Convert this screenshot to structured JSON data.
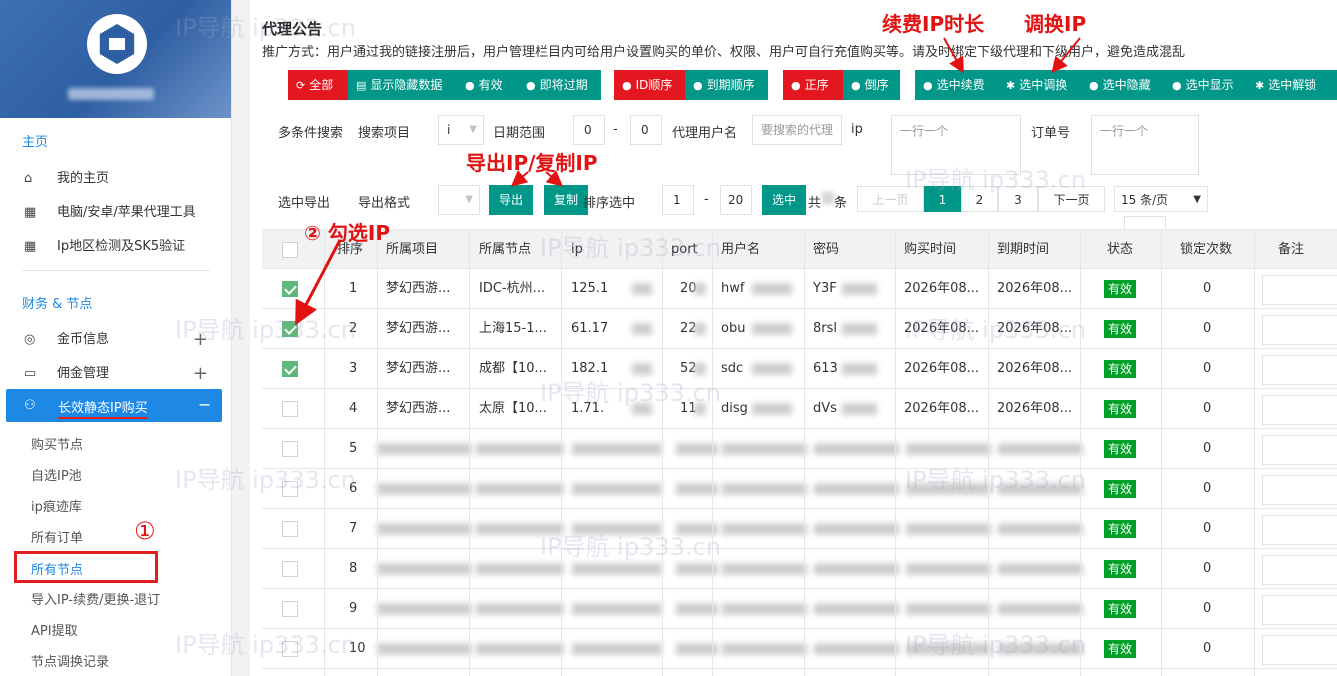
{
  "sidebar": {
    "section_main": "主页",
    "items_main": [
      {
        "label": "我的主页",
        "icon": "home-icon"
      },
      {
        "label": "电脑/安卓/苹果代理工具",
        "icon": "grid-icon"
      },
      {
        "label": "Ip地区检测及SK5验证",
        "icon": "grid-icon"
      }
    ],
    "section_finance": "财务 & 节点",
    "items_finance": [
      {
        "label": "金币信息",
        "toggle": "+"
      },
      {
        "label": "佣金管理",
        "toggle": "+"
      }
    ],
    "active_item": {
      "label": "长效静态IP购买",
      "toggle": "−"
    },
    "sub_items": [
      "购买节点",
      "自选IP池",
      "ip痕迹库",
      "所有订单",
      "所有节点",
      "导入IP-续费/更换-退订",
      "API提取",
      "节点调换记录"
    ]
  },
  "notice": {
    "title": "代理公告",
    "text": "推广方式：用户通过我的链接注册后，用户管理栏目内可给用户设置购买的单价、权限、用户可自行充值购买等。请及时绑定下级代理和下级用户，避免造成混乱"
  },
  "toolbar": [
    {
      "label": "全部",
      "color": "red",
      "icon": "cycle-icon"
    },
    {
      "label": "显示隐藏数据",
      "color": "teal",
      "icon": "list-icon"
    },
    {
      "label": "有效",
      "color": "teal",
      "icon": "check-circle-icon"
    },
    {
      "label": "即将过期",
      "color": "teal",
      "icon": "check-circle-icon"
    },
    {
      "label": "ID顺序",
      "color": "red",
      "icon": "check-circle-icon"
    },
    {
      "label": "到期顺序",
      "color": "teal",
      "icon": "check-circle-icon"
    },
    {
      "label": "正序",
      "color": "red",
      "icon": "check-circle-icon"
    },
    {
      "label": "倒序",
      "color": "teal",
      "icon": "check-circle-icon"
    },
    {
      "label": "选中续费",
      "color": "teal",
      "icon": "check-circle-icon"
    },
    {
      "label": "选中调换",
      "color": "teal",
      "icon": "gear-icon"
    },
    {
      "label": "选中隐藏",
      "color": "teal",
      "icon": "check-circle-icon"
    },
    {
      "label": "选中显示",
      "color": "teal",
      "icon": "check-circle-icon"
    },
    {
      "label": "选中解锁",
      "color": "teal",
      "icon": "gear-icon"
    }
  ],
  "filters": {
    "multi_label": "多条件搜索",
    "project_label": "搜索项目",
    "project_value": "i",
    "date_label": "日期范围",
    "date_from": "0",
    "date_sep": "-",
    "date_to": "0",
    "agent_label": "代理用户名",
    "agent_placeholder": "要搜索的代理",
    "ip_label": "ip",
    "ip_placeholder": "一行一个",
    "order_label": "订单号",
    "order_placeholder": "一行一个"
  },
  "export": {
    "label": "选中导出",
    "format_label": "导出格式",
    "export_btn": "导出",
    "copy_btn": "复制",
    "sort_label": "排序选中",
    "range_from": "1",
    "range_sep": "-",
    "range_to": "20",
    "select_btn": "选中",
    "total_prefix": "共",
    "total_suffix": "条"
  },
  "pagination": {
    "prev": "上一页",
    "pages": [
      "1",
      "2",
      "3"
    ],
    "next": "下一页",
    "per_page": "15 条/页"
  },
  "table": {
    "headers": [
      "排序",
      "所属项目",
      "所属节点",
      "ip",
      "port",
      "用户名",
      "密码",
      "购买时间",
      "到期时间",
      "状态",
      "锁定次数",
      "备注"
    ],
    "rows": [
      {
        "checked": true,
        "sort": "1",
        "project": "梦幻西游...",
        "node": "IDC-杭州...",
        "ip": "125.1",
        "port": "20",
        "user": "hwf",
        "pass": "Y3F",
        "buy": "2026年08...",
        "expire": "2026年08...",
        "status": "有效",
        "lock": "0"
      },
      {
        "checked": true,
        "sort": "2",
        "project": "梦幻西游...",
        "node": "上海15-1...",
        "ip": "61.17",
        "port": "22",
        "user": "obu",
        "pass": "8rsl",
        "buy": "2026年08...",
        "expire": "2026年08...",
        "status": "有效",
        "lock": "0"
      },
      {
        "checked": true,
        "sort": "3",
        "project": "梦幻西游...",
        "node": "成都【10...",
        "ip": "182.1",
        "port": "52",
        "user": "sdc",
        "pass": "613",
        "buy": "2026年08...",
        "expire": "2026年08...",
        "status": "有效",
        "lock": "0"
      },
      {
        "checked": false,
        "sort": "4",
        "project": "梦幻西游...",
        "node": "太原【10...",
        "ip": "1.71.",
        "port": "11",
        "user": "disg",
        "pass": "dVs",
        "buy": "2026年08...",
        "expire": "2026年08...",
        "status": "有效",
        "lock": "0"
      },
      {
        "checked": false,
        "sort": "5",
        "status": "有效",
        "lock": "0"
      },
      {
        "checked": false,
        "sort": "6",
        "status": "有效",
        "lock": "0"
      },
      {
        "checked": false,
        "sort": "7",
        "status": "有效",
        "lock": "0"
      },
      {
        "checked": false,
        "sort": "8",
        "status": "有效",
        "lock": "0"
      },
      {
        "checked": false,
        "sort": "9",
        "status": "有效",
        "lock": "0"
      },
      {
        "checked": false,
        "sort": "10",
        "status": "有效",
        "lock": "0"
      }
    ]
  },
  "annotations": {
    "renew": "续费IP时长",
    "swap": "调换IP",
    "export_copy": "导出IP/复制IP",
    "check_ip": "② 勾选IP",
    "step1": "①"
  },
  "watermark": "IP导航  ip333.cn",
  "colors": {
    "red": "#e4161f",
    "teal": "#009688",
    "blue": "#1e88e5",
    "status_green": "#009f27",
    "annotation": "#e21212"
  }
}
